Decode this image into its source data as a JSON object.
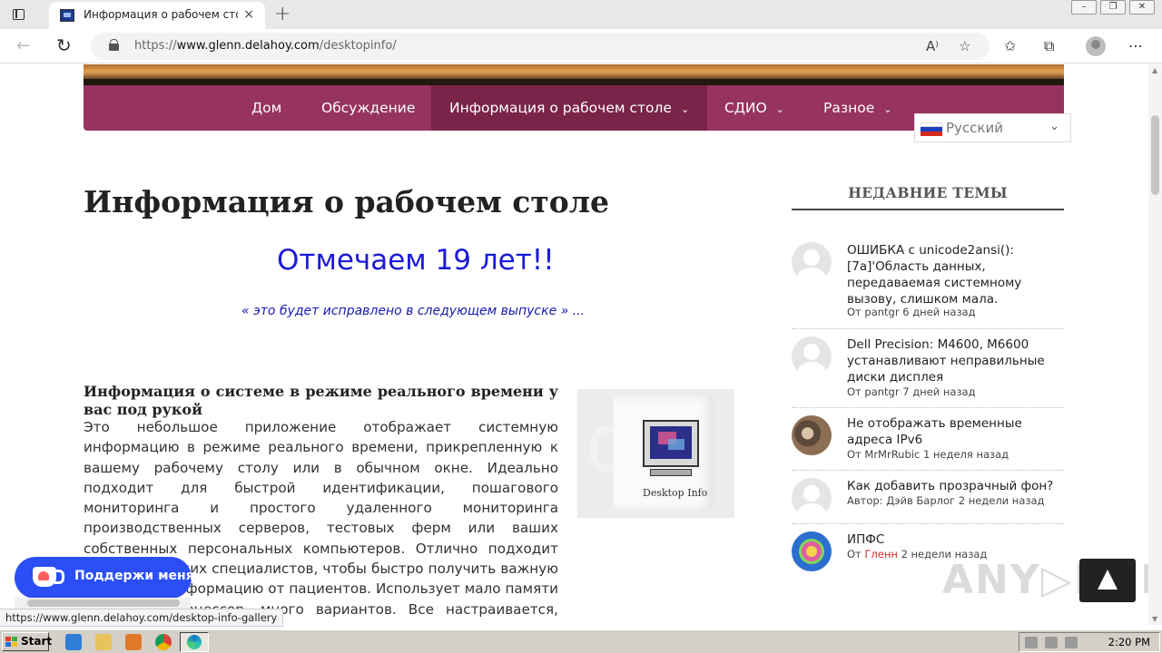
{
  "browser": {
    "tab_title": "Информация о рабочем столе",
    "tab_close": "×",
    "new_tab": "+",
    "url_prefix": "https://",
    "url_host": "www.glenn.delahoy.com",
    "url_path": "/desktopinfo/"
  },
  "nav": {
    "items": [
      {
        "label": "Дом"
      },
      {
        "label": "Обсуждение"
      },
      {
        "label": "Информация о рабочем столе"
      },
      {
        "label": "СДИО"
      },
      {
        "label": "Разное"
      }
    ],
    "chevron": "⌄",
    "active_color": "#7a2449",
    "bar_color": "#96335f"
  },
  "language": {
    "selected": "Русский"
  },
  "main": {
    "page_title": "Информация о рабочем столе",
    "celebrate": "Отмечаем 19 лет!!",
    "quote": "« это будет исправлено в следующем выпуске » ...",
    "section_heading": "Информация о системе в режиме реального времени у вас под рукой",
    "body_text": "Это небольшое приложение отображает системную информацию в режиме реального времени, прикрепленную к вашему рабочему столу или в обычном окне. Идеально подходит для быстрой идентификации, пошагового мониторинга и простого удаленного мониторинга производственных серверов, тестовых ферм или ваших собственных персональных компьютеров. Отлично подходит для технических специалистов, чтобы быстро получить важную системную информацию от пациентов. Использует мало памяти и низкий процессор, много вариантов. Все настраивается, включая",
    "mug_label": "Desktop Info"
  },
  "sidebar": {
    "title": "НЕДАВНИЕ ТЕМЫ",
    "topics": [
      {
        "title": "ОШИБКА с unicode2ansi(): [7a]'Область данных, передаваемая системному вызову, слишком мала.",
        "meta_prefix": "От pantgr 6 дней назад",
        "avatar": "generic-avatar"
      },
      {
        "title": "Dell Precision: M4600, M6600 устанавливают неправильные диски дисплея",
        "meta_prefix": "От pantgr 7 дней назад",
        "avatar": "generic-avatar"
      },
      {
        "title": "Не отображать временные адреса IPv6",
        "meta_prefix": "От MrMrRubic 1 неделя назад",
        "avatar": "cat-avatar"
      },
      {
        "title": "Как добавить прозрачный фон?",
        "meta_prefix": "Автор: Дэйв Барлог 2 недели назад",
        "avatar": "generic-avatar"
      },
      {
        "title": "ИПФС",
        "meta_prefix": "От",
        "meta_author": "Гленн",
        "meta_suffix": "2 недели назад",
        "avatar": "peace-avatar"
      }
    ]
  },
  "kofi": {
    "label": "Поддержи меня"
  },
  "status_url": "https://www.glenn.delahoy.com/desktop-info-gallery",
  "watermark": "ANY▷RUN",
  "taskbar": {
    "start": "Start",
    "clock": "2:20 PM"
  }
}
